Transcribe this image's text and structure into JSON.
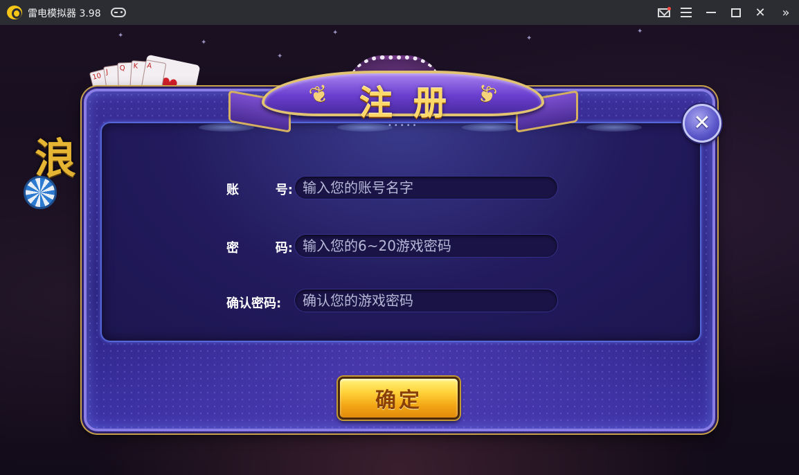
{
  "titlebar": {
    "app_title": "雷电模拟器 3.98",
    "close_glyph": "✕",
    "more_glyph": "»",
    "notification_color": "#ff4a3d"
  },
  "background": {
    "logo_text": "浪",
    "card_ranks": [
      "10",
      "J",
      "Q",
      "K",
      "A"
    ],
    "heart_glyph": "♥"
  },
  "dialog": {
    "title": "注册",
    "laurel_glyph": "❦",
    "ribbon_dots": "•••••",
    "close_glyph": "✕",
    "fields": [
      {
        "label_a": "账",
        "label_b": "号:",
        "placeholder": "输入您的账号名字"
      },
      {
        "label_a": "密",
        "label_b": "码:",
        "placeholder": "输入您的6~20游戏密码"
      },
      {
        "label": "确认密码:",
        "placeholder": "确认您的游戏密码"
      }
    ],
    "confirm_label": "确定",
    "accent_gold": "#ffd23a",
    "panel_blue": "#2c2380"
  }
}
